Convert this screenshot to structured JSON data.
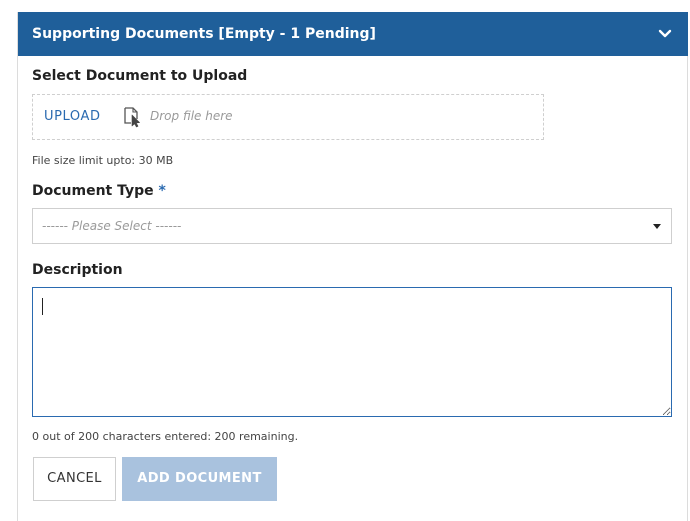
{
  "panel": {
    "title": "Supporting Documents [Empty - 1 Pending]",
    "collapse_icon": "chevron-down-icon"
  },
  "upload": {
    "section_label": "Select Document to Upload",
    "upload_link": "UPLOAD",
    "file_icon": "file-cursor-icon",
    "drop_placeholder": "Drop file here",
    "size_limit": "File size limit upto: 30 MB"
  },
  "document_type": {
    "label": "Document Type",
    "required_marker": "*",
    "selected": "------ Please Select ------"
  },
  "description": {
    "label": "Description",
    "value": "",
    "counter": "0 out of 200 characters entered: 200 remaining."
  },
  "actions": {
    "cancel": "CANCEL",
    "add_document": "ADD DOCUMENT"
  },
  "colors": {
    "header_bg": "#1f5f9a",
    "accent": "#2a6ab0",
    "disabled_button": "#a9c2de"
  }
}
